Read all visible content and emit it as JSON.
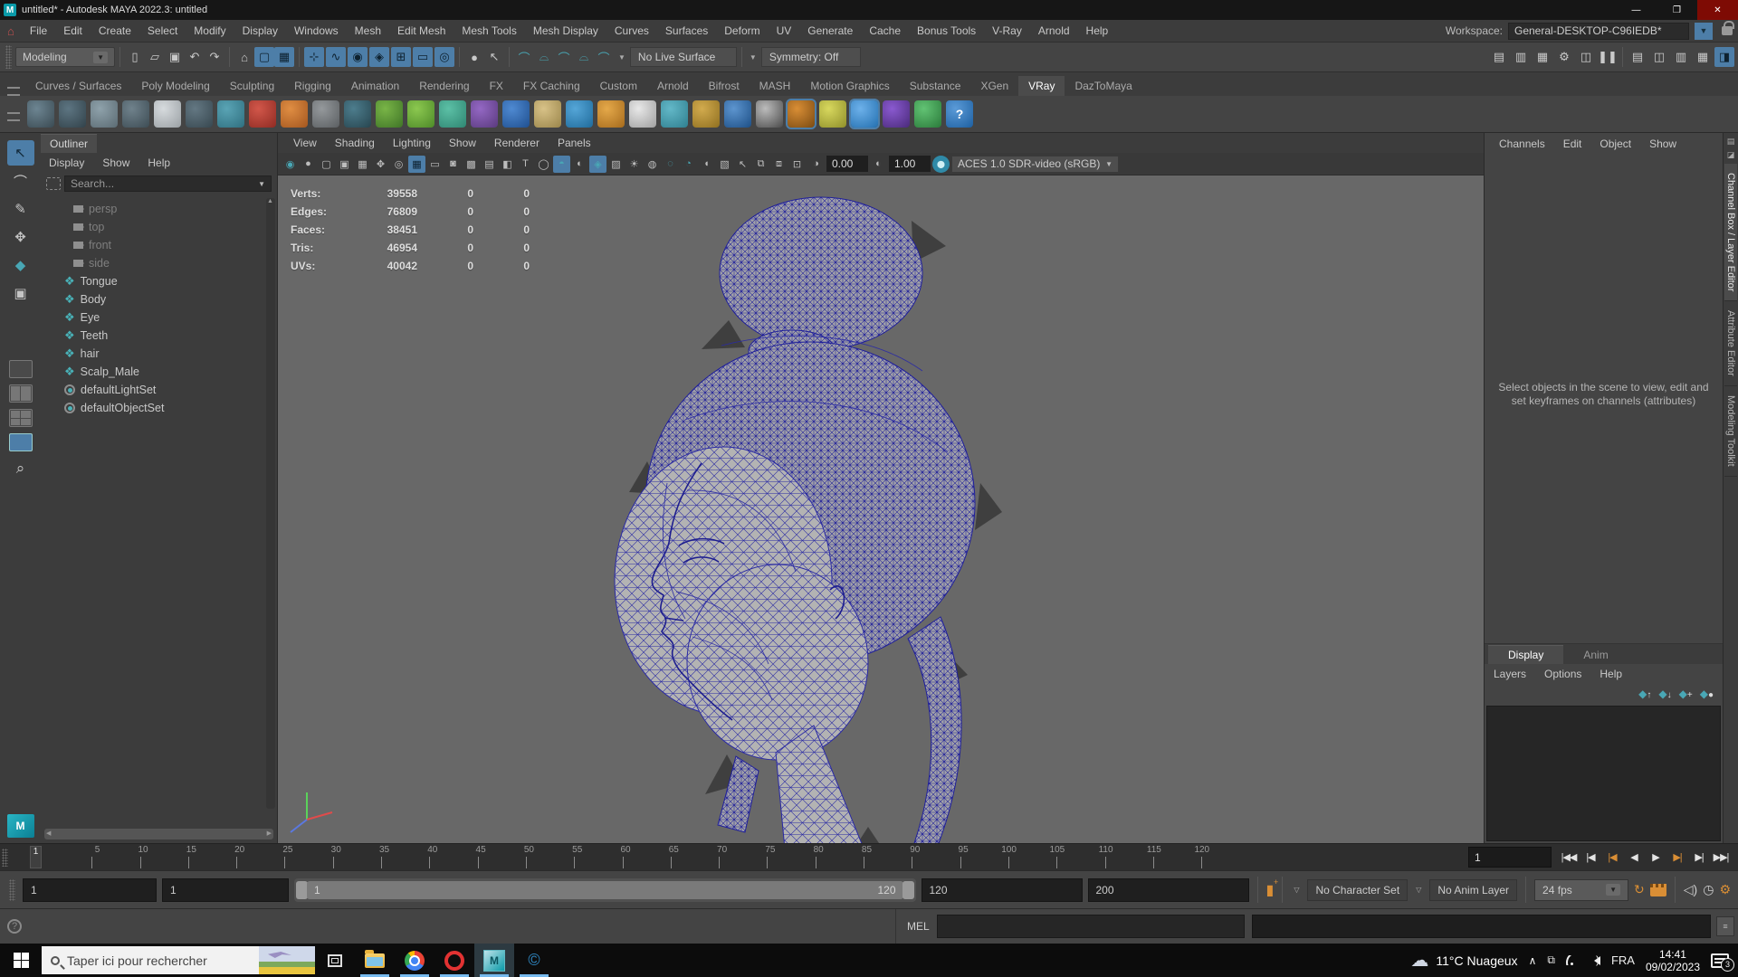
{
  "window": {
    "title": "untitled* - Autodesk MAYA 2022.3: untitled",
    "controls": {
      "minimize": "—",
      "maximize": "❐",
      "close": "✕"
    }
  },
  "menubar": {
    "items": [
      "File",
      "Edit",
      "Create",
      "Select",
      "Modify",
      "Display",
      "Windows",
      "Mesh",
      "Edit Mesh",
      "Mesh Tools",
      "Mesh Display",
      "Curves",
      "Surfaces",
      "Deform",
      "UV",
      "Generate",
      "Cache",
      "Bonus Tools",
      "V-Ray",
      "Arnold",
      "Help"
    ]
  },
  "workspace": {
    "label": "Workspace:",
    "value": "General-DESKTOP-C96IEDB*"
  },
  "statusline": {
    "mode": "Modeling",
    "no_live_surface": "No Live Surface",
    "symmetry": "Symmetry: Off",
    "file_icons": [
      {
        "name": "new-scene-icon",
        "glyph": "▯"
      },
      {
        "name": "open-scene-icon",
        "glyph": "▱"
      },
      {
        "name": "save-scene-icon",
        "glyph": "▣"
      },
      {
        "name": "undo-icon",
        "glyph": "↶"
      },
      {
        "name": "redo-icon",
        "glyph": "↷"
      }
    ],
    "mask_icons": [
      {
        "name": "select-hierarchy-icon",
        "glyph": "⌂"
      },
      {
        "name": "select-object-icon",
        "glyph": "▢",
        "active": true
      },
      {
        "name": "select-component-icon",
        "glyph": "▦",
        "active": true
      }
    ],
    "snap_icons": [
      {
        "name": "snap-grid-icon",
        "glyph": "⊹",
        "active": true
      },
      {
        "name": "snap-curve-icon",
        "glyph": "∿",
        "active": true
      },
      {
        "name": "snap-point-icon",
        "glyph": "◉",
        "active": true
      },
      {
        "name": "snap-center-icon",
        "glyph": "◈",
        "active": true
      },
      {
        "name": "snap-axis-icon",
        "glyph": "⊞",
        "active": true
      },
      {
        "name": "snap-viewplane-icon",
        "glyph": "▭",
        "active": true
      },
      {
        "name": "make-live-icon",
        "glyph": "◎",
        "active": true
      }
    ],
    "history_icons": [
      {
        "name": "lock-selection-icon",
        "glyph": "●"
      },
      {
        "name": "highlight-selection-icon",
        "glyph": "↖"
      }
    ],
    "rivet_icons": [
      {
        "name": "snap-together-icon",
        "glyph": "⌒"
      },
      {
        "name": "curve-snap-icon",
        "glyph": "⌓"
      },
      {
        "name": "edge-snap-icon",
        "glyph": "⌒"
      },
      {
        "name": "multi-snap-icon",
        "glyph": "⌓"
      },
      {
        "name": "surface-snap-icon",
        "glyph": "⌒"
      }
    ],
    "render_icons": [
      {
        "name": "render-view-icon",
        "glyph": "▤"
      },
      {
        "name": "render-current-icon",
        "glyph": "▥"
      },
      {
        "name": "ipr-render-icon",
        "glyph": "▦"
      },
      {
        "name": "render-settings-icon",
        "glyph": "⚙"
      },
      {
        "name": "light-editor-icon",
        "glyph": "◫"
      },
      {
        "name": "pause-icon",
        "glyph": "❚❚"
      }
    ],
    "sidebar_icons": [
      {
        "name": "attribute-editor-toggle-icon",
        "glyph": "▤"
      },
      {
        "name": "tool-settings-toggle-icon",
        "glyph": "◫"
      },
      {
        "name": "channel-box-toggle-icon",
        "glyph": "▥"
      },
      {
        "name": "modeling-toolkit-toggle-icon",
        "glyph": "▦"
      },
      {
        "name": "workspace-toggle-icon",
        "glyph": "◨",
        "active": true
      }
    ]
  },
  "shelf": {
    "tabs": [
      {
        "label": "Curves / Surfaces"
      },
      {
        "label": "Poly Modeling"
      },
      {
        "label": "Sculpting"
      },
      {
        "label": "Rigging"
      },
      {
        "label": "Animation"
      },
      {
        "label": "Rendering"
      },
      {
        "label": "FX"
      },
      {
        "label": "FX Caching"
      },
      {
        "label": "Custom"
      },
      {
        "label": "Arnold"
      },
      {
        "label": "Bifrost"
      },
      {
        "label": "MASH"
      },
      {
        "label": "Motion Graphics"
      },
      {
        "label": "Substance"
      },
      {
        "label": "XGen"
      },
      {
        "label": "VRay",
        "active": true
      },
      {
        "label": "DazToMaya"
      }
    ],
    "icons": [
      {
        "name": "shelf-icon-sphere-wire",
        "c": "#3a4a52",
        "c2": "#6d8592"
      },
      {
        "name": "shelf-icon-sphere-wire2",
        "c": "#32424a",
        "c2": "#5d7582"
      },
      {
        "name": "shelf-icon-panel",
        "c": "#5b6b73",
        "c2": "#8fa2ab"
      },
      {
        "name": "shelf-icon-eyedropper",
        "c": "#3d4c54",
        "c2": "#70828c"
      },
      {
        "name": "shelf-icon-notes",
        "c": "#9aa0a4",
        "c2": "#d7dbde"
      },
      {
        "name": "shelf-icon-dark-sphere",
        "c": "#37474f",
        "c2": "#647883"
      },
      {
        "name": "shelf-icon-proxy",
        "c": "#2f6f7f",
        "c2": "#5aa4b5"
      },
      {
        "name": "shelf-icon-red-material",
        "c": "#8f2b23",
        "c2": "#d2574a"
      },
      {
        "name": "shelf-icon-orange-sphere",
        "c": "#a3561f",
        "c2": "#e08e43"
      },
      {
        "name": "shelf-icon-gray-box",
        "c": "#5a5e61",
        "c2": "#95999c"
      },
      {
        "name": "shelf-icon-dome-light",
        "c": "#27454f",
        "c2": "#4d7d8d"
      },
      {
        "name": "shelf-icon-grass",
        "c": "#3f7427",
        "c2": "#79b547"
      },
      {
        "name": "shelf-icon-plant",
        "c": "#4d8a28",
        "c2": "#8cc850"
      },
      {
        "name": "shelf-icon-fur",
        "c": "#2f8672",
        "c2": "#5cc0a6"
      },
      {
        "name": "shelf-icon-purple-swirl",
        "c": "#5a3a7e",
        "c2": "#9468c4"
      },
      {
        "name": "shelf-icon-blue-sphere",
        "c": "#1f4f8f",
        "c2": "#4f8ad2"
      },
      {
        "name": "shelf-icon-sand-curve",
        "c": "#9a854a",
        "c2": "#d8c288"
      },
      {
        "name": "shelf-icon-water",
        "c": "#1f6a9a",
        "c2": "#55a6d8"
      },
      {
        "name": "shelf-icon-cone-light",
        "c": "#a56a1c",
        "c2": "#e5a94a"
      },
      {
        "name": "shelf-icon-white-sphere",
        "c": "#9f9f9f",
        "c2": "#e8e8e8"
      },
      {
        "name": "shelf-icon-teal-cone",
        "c": "#2f7f8f",
        "c2": "#63b8c8"
      },
      {
        "name": "shelf-icon-gold-ring",
        "c": "#8f6f20",
        "c2": "#d2ab4e"
      },
      {
        "name": "shelf-icon-glass-sphere",
        "c": "#1d4f86",
        "c2": "#5d95cf"
      },
      {
        "name": "shelf-icon-checker",
        "c": "#4a4a4a",
        "c2": "#bcbcbc"
      },
      {
        "name": "shelf-icon-vray-camera",
        "c": "#7a4a12",
        "c2": "#d98e35",
        "active": true
      },
      {
        "name": "shelf-icon-character",
        "c": "#8f8f2a",
        "c2": "#d8d85e"
      },
      {
        "name": "shelf-icon-cloud",
        "c": "#2470b0",
        "c2": "#6db1ea",
        "active": true
      },
      {
        "name": "shelf-icon-vray-logo",
        "c": "#4a2a7a",
        "c2": "#8a5ad0"
      },
      {
        "name": "shelf-icon-balls",
        "c": "#2a7a3a",
        "c2": "#62c374"
      },
      {
        "name": "shelf-icon-help",
        "c": "#1d5fa0",
        "c2": "#5b9bd8",
        "glyph": "?"
      }
    ]
  },
  "toolbox": {
    "tools": [
      {
        "name": "select-tool",
        "glyph": "↖",
        "active": true
      },
      {
        "name": "lasso-tool",
        "glyph": "⌒"
      },
      {
        "name": "paint-select-tool",
        "glyph": "✎"
      },
      {
        "name": "move-tool",
        "glyph": "✥"
      },
      {
        "name": "rotate-tool",
        "glyph": "◆",
        "teal": true
      },
      {
        "name": "scale-tool",
        "glyph": "▣"
      }
    ]
  },
  "outliner": {
    "tab": "Outliner",
    "menus": [
      "Display",
      "Show",
      "Help"
    ],
    "search_placeholder": "Search...",
    "items": [
      {
        "label": "persp",
        "type": "camera",
        "muted": true
      },
      {
        "label": "top",
        "type": "camera",
        "muted": true
      },
      {
        "label": "front",
        "type": "camera",
        "muted": true
      },
      {
        "label": "side",
        "type": "camera",
        "muted": true
      },
      {
        "label": "Tongue",
        "type": "mesh"
      },
      {
        "label": "Body",
        "type": "mesh"
      },
      {
        "label": "Eye",
        "type": "mesh"
      },
      {
        "label": "Teeth",
        "type": "mesh"
      },
      {
        "label": "hair",
        "type": "mesh"
      },
      {
        "label": "Scalp_Male",
        "type": "mesh"
      },
      {
        "label": "defaultLightSet",
        "type": "set"
      },
      {
        "label": "defaultObjectSet",
        "type": "set"
      }
    ]
  },
  "viewport": {
    "menus": [
      "View",
      "Shading",
      "Lighting",
      "Show",
      "Renderer",
      "Panels"
    ],
    "toolbar_icons": [
      {
        "name": "selected-camera-icon",
        "glyph": "◉",
        "teal": true
      },
      {
        "name": "lock-camera-icon",
        "glyph": "●"
      },
      {
        "name": "camera-attributes-icon",
        "glyph": "▢"
      },
      {
        "name": "bookmarks-icon",
        "glyph": "▣"
      },
      {
        "name": "image-plane-icon",
        "glyph": "▦"
      },
      {
        "name": "2d-pan-zoom-icon",
        "glyph": "✥"
      },
      {
        "name": "oversampling-icon",
        "glyph": "◎"
      },
      {
        "name": "grid-icon",
        "glyph": "▦",
        "active": true
      },
      {
        "name": "film-gate-icon",
        "glyph": "▭"
      },
      {
        "name": "resolution-gate-icon",
        "glyph": "◙"
      },
      {
        "name": "gate-mask-icon",
        "glyph": "▩"
      },
      {
        "name": "field-chart-icon",
        "glyph": "▤"
      },
      {
        "name": "safe-action-icon",
        "glyph": "◧"
      },
      {
        "name": "safe-title-icon",
        "glyph": "T"
      },
      {
        "name": "wireframe-icon",
        "glyph": "◯"
      },
      {
        "name": "shaded-icon",
        "glyph": "◓",
        "active": true,
        "teal": true
      },
      {
        "name": "textured-icon",
        "glyph": "◐"
      },
      {
        "name": "use-all-lights-icon",
        "glyph": "◈",
        "active": true,
        "teal": true
      },
      {
        "name": "shadows-icon",
        "glyph": "▨"
      },
      {
        "name": "screen-space-ao-icon",
        "glyph": "☀"
      },
      {
        "name": "motion-blur-icon",
        "glyph": "◍"
      },
      {
        "name": "multisample-icon",
        "glyph": "◌",
        "teal": true
      },
      {
        "name": "depth-of-field-icon",
        "glyph": "◔",
        "teal": true
      },
      {
        "name": "isolate-select-icon",
        "glyph": "◖"
      },
      {
        "name": "xray-icon",
        "glyph": "▧"
      },
      {
        "name": "selection-highlight-icon",
        "glyph": "↖"
      },
      {
        "name": "plugin-shapes-icon",
        "glyph": "⧉"
      },
      {
        "name": "texture-placement-icon",
        "glyph": "⧈"
      },
      {
        "name": "viewport-renderer-icon",
        "glyph": "⊡"
      }
    ],
    "exposure_icon": "◑",
    "exposure": "0.00",
    "gamma_icon": "◐",
    "gamma": "1.00",
    "cms_icon": "cms",
    "colorspace": "ACES 1.0 SDR-video (sRGB)",
    "hud": {
      "rows": [
        {
          "label": "Verts:",
          "value": "39558",
          "c1": "0",
          "c2": "0"
        },
        {
          "label": "Edges:",
          "value": "76809",
          "c1": "0",
          "c2": "0"
        },
        {
          "label": "Faces:",
          "value": "38451",
          "c1": "0",
          "c2": "0"
        },
        {
          "label": "Tris:",
          "value": "46954",
          "c1": "0",
          "c2": "0"
        },
        {
          "label": "UVs:",
          "value": "40042",
          "c1": "0",
          "c2": "0"
        }
      ]
    }
  },
  "channel_box": {
    "menus": [
      "Channels",
      "Edit",
      "Object",
      "Show"
    ],
    "message": "Select objects in the scene to view, edit and set keyframes on channels (attributes)"
  },
  "layer_editor": {
    "tabs": [
      {
        "label": "Display",
        "active": true
      },
      {
        "label": "Anim"
      }
    ],
    "menus": [
      "Layers",
      "Options",
      "Help"
    ],
    "icons": [
      {
        "name": "move-layer-up-icon",
        "glyph": "◆",
        "extra": "↑"
      },
      {
        "name": "move-layer-down-icon",
        "glyph": "◆",
        "extra": "↓"
      },
      {
        "name": "new-layer-icon",
        "glyph": "◆",
        "extra": "+"
      },
      {
        "name": "new-layer-selected-icon",
        "glyph": "◆",
        "extra": "●"
      }
    ]
  },
  "side_tabs": [
    {
      "label": "Channel Box / Layer Editor",
      "active": true
    },
    {
      "label": "Attribute Editor"
    },
    {
      "label": "Modeling Toolkit"
    }
  ],
  "timeline": {
    "current_frame": "1",
    "ticks": [
      "5",
      "10",
      "15",
      "20",
      "25",
      "30",
      "35",
      "40",
      "45",
      "50",
      "55",
      "60",
      "65",
      "70",
      "75",
      "80",
      "85",
      "90",
      "95",
      "100",
      "105",
      "110",
      "115",
      "120"
    ],
    "frame_field": "1",
    "playback": [
      {
        "name": "go-to-start-button",
        "glyph": "|◀◀"
      },
      {
        "name": "step-back-frame-button",
        "glyph": "|◀"
      },
      {
        "name": "step-back-key-button",
        "glyph": "|◀",
        "accent": true
      },
      {
        "name": "play-backward-button",
        "glyph": "◀"
      },
      {
        "name": "play-forward-button",
        "glyph": "▶"
      },
      {
        "name": "step-forward-key-button",
        "glyph": "▶|",
        "accent": true
      },
      {
        "name": "step-forward-frame-button",
        "glyph": "▶|"
      },
      {
        "name": "go-to-end-button",
        "glyph": "▶▶|"
      }
    ]
  },
  "range": {
    "anim_start": "1",
    "playback_start": "1",
    "slider_start": "1",
    "slider_end": "120",
    "playback_end": "120",
    "anim_end": "200",
    "character_set": "No Character Set",
    "anim_layer": "No Anim Layer",
    "fps": "24 fps"
  },
  "command_line": {
    "label": "MEL"
  },
  "taskbar": {
    "search_placeholder": "Taper ici pour rechercher",
    "weather": "11°C Nuageux",
    "chevron": "∧",
    "language": "FRA",
    "time": "14:41",
    "date": "09/02/2023",
    "notification_count": "3"
  }
}
